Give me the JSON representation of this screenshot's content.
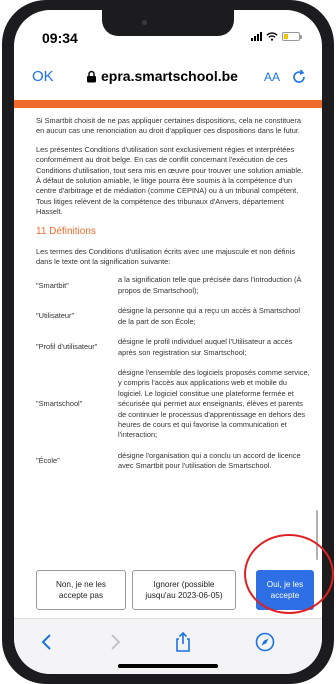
{
  "status_bar": {
    "time": "09:34"
  },
  "browser": {
    "done_label": "OK",
    "url": "epra.smartschool.be",
    "text_size_label": "AA"
  },
  "content": {
    "paragraph_1": "Si Smartbit choisit de ne pas appliquer certaines dispositions, cela ne constituera en aucun cas une renonciation au droit d'appliquer ces dispositions dans le futur.",
    "paragraph_2": "Les présentes Conditions d'utilisation sont exclusivement régies et interprétées conformément au droit belge. En cas de conflit concernant l'exécution de ces Conditions d'utilisation, tout sera mis en œuvre pour trouver une solution amiable. À défaut de solution amiable, le litige pourra être soumis à la compétence d'un centre d'arbitrage et de médiation (comme CEPINA) ou à un tribunal compétent. Tous litiges relèvent de la compétence des tribunaux d'Anvers, département Hasselt.",
    "section_heading": "11 Définitions",
    "section_intro": "Les termes des Conditions d'utilisation écrits avec une majuscule et non définis dans le texte ont la signification suivante:",
    "definitions": [
      {
        "term": "\"Smartbit\"",
        "desc": "a la signification telle que précisée dans l'introduction (À propos de Smartschool);"
      },
      {
        "term": "\"Utilisateur\"",
        "desc": "désigne la personne qui a reçu un accès à Smartschool de la part de son École;"
      },
      {
        "term": "\"Profil d'utilisateur\"",
        "desc": "désigne le profil individuel auquel l'Utilisateur a accès après son registration sur Smartschool;"
      },
      {
        "term": "\"Smartschool\"",
        "desc": "désigne l'ensemble des logiciels proposés comme service, y compris l'accès aux applications web et mobile du logiciel. Le logiciel constitue une plateforme fermée et sécurisée qui permet aux enseignants, élèves et parents de continuer le processus d'apprentissage en dehors des heures de cours et qui favorise la communication et l'interaction;"
      },
      {
        "term": "\"École\"",
        "desc": "désigne l'organisation qui a conclu un accord de licence avec Smartbit pour l'utilisation de Smartschool."
      }
    ]
  },
  "actions": {
    "refuse_label": "Non, je ne les accepte pas",
    "ignore_label": "Ignorer (possible jusqu'au 2023-06-05)",
    "accept_label": "Oui, je les accepte"
  },
  "colors": {
    "accent": "#f26a2b",
    "primary": "#2f6fe6",
    "link": "#1a73e8",
    "highlight": "#e02020"
  },
  "toolbar_icons": [
    "back-icon",
    "forward-icon",
    "share-icon",
    "compass-icon"
  ]
}
